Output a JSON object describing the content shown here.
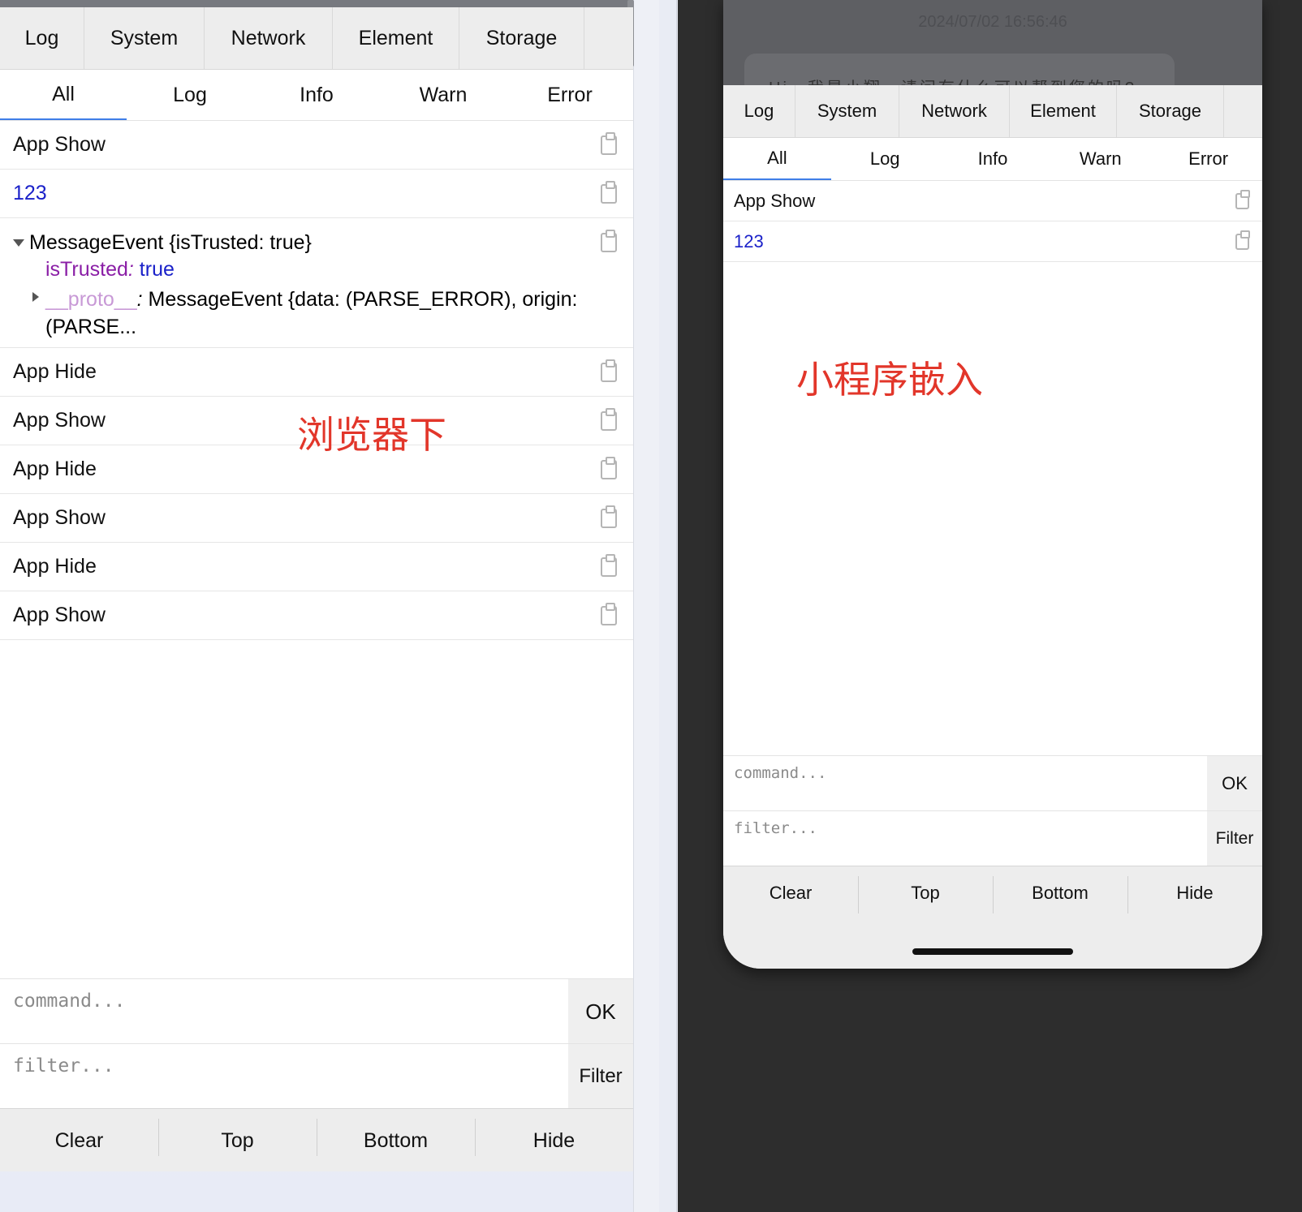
{
  "browser_panel": {
    "tabs": [
      "Log",
      "System",
      "Network",
      "Element",
      "Storage"
    ],
    "subtabs": [
      "All",
      "Log",
      "Info",
      "Warn",
      "Error"
    ],
    "active_subtab": "All",
    "logs_before": [
      {
        "text": "App Show",
        "type": "text"
      },
      {
        "text": "123",
        "type": "number"
      }
    ],
    "message_event": {
      "summary": "MessageEvent {isTrusted: true}",
      "prop_key": "isTrusted",
      "prop_sep": ":",
      "prop_value": "true",
      "proto_key": "__proto__",
      "proto_sep": ":",
      "proto_value": "MessageEvent {data: (PARSE_ERROR), origin:",
      "proto_value_cont": "(PARSE..."
    },
    "logs_after": [
      {
        "text": "App Hide"
      },
      {
        "text": "App Show"
      },
      {
        "text": "App Hide"
      },
      {
        "text": "App Show"
      },
      {
        "text": "App Hide"
      },
      {
        "text": "App Show"
      }
    ],
    "command_placeholder": "command...",
    "ok_label": "OK",
    "filter_placeholder": "filter...",
    "filter_label": "Filter",
    "toolbar": [
      "Clear",
      "Top",
      "Bottom",
      "Hide"
    ],
    "annotation": "浏览器下"
  },
  "phone_panel": {
    "header_date": "2024/07/02 16:56:46",
    "header_bubble": "Hi，我是小翔，请问有什么可以帮到您的吗?",
    "tabs": [
      "Log",
      "System",
      "Network",
      "Element",
      "Storage"
    ],
    "subtabs": [
      "All",
      "Log",
      "Info",
      "Warn",
      "Error"
    ],
    "active_subtab": "All",
    "logs": [
      {
        "text": "App Show",
        "type": "text"
      },
      {
        "text": "123",
        "type": "number"
      }
    ],
    "command_placeholder": "command...",
    "ok_label": "OK",
    "filter_placeholder": "filter...",
    "filter_label": "Filter",
    "toolbar": [
      "Clear",
      "Top",
      "Bottom",
      "Hide"
    ],
    "annotation": "小程序嵌入"
  },
  "colors": {
    "annotation": "#e2362a",
    "number": "#1a21c9",
    "active_tab_underline": "#3f7ee8",
    "key_purple": "#8a1ea6"
  }
}
